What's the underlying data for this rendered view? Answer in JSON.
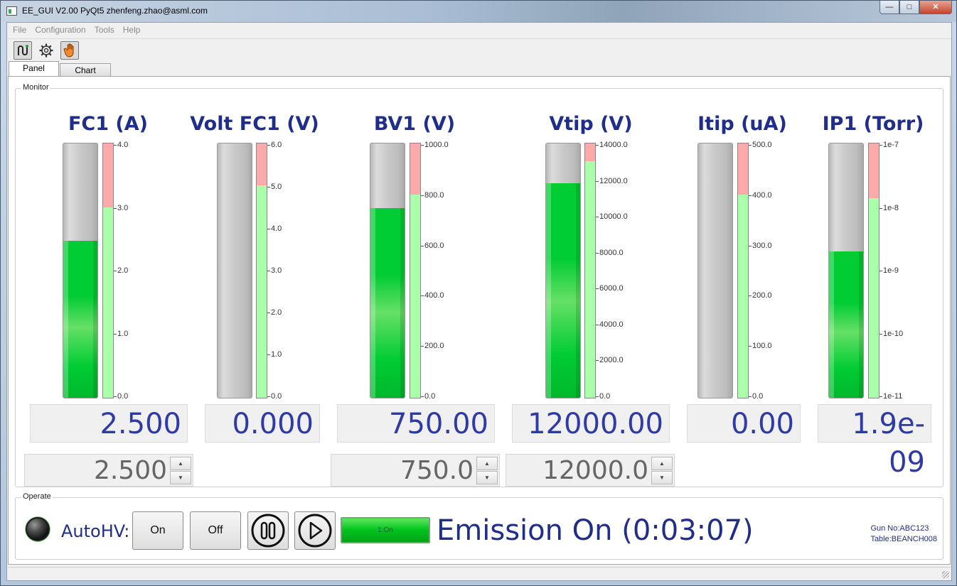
{
  "window": {
    "title": "EE_GUI V2.00 PyQt5 zhenfeng.zhao@asml.com"
  },
  "menu": [
    "File",
    "Configuration",
    "Tools",
    "Help"
  ],
  "toolbar": {
    "icons": [
      "connect-icon",
      "gear-icon",
      "hand-icon"
    ]
  },
  "tabs": [
    {
      "label": "Panel",
      "selected": true
    },
    {
      "label": "Chart",
      "selected": false
    }
  ],
  "monitor": {
    "title": "Monitor",
    "gauges": [
      {
        "id": "fc1",
        "title": "FC1 (A)",
        "readout": "2.500",
        "setpoint": "2.500",
        "has_setpoint": true,
        "fill_fraction": 0.617,
        "red_fraction": 0.25,
        "ticks": [
          "4.0",
          "3.0",
          "2.0",
          "1.0",
          "0.0"
        ]
      },
      {
        "id": "voltfc1",
        "title": "Volt FC1  (V)",
        "readout": "0.000",
        "has_setpoint": false,
        "fill_fraction": 0.0,
        "red_fraction": 0.166,
        "ticks": [
          "6.0",
          "5.0",
          "4.0",
          "3.0",
          "2.0",
          "1.0",
          "0.0"
        ]
      },
      {
        "id": "bv1",
        "title": "BV1 (V)",
        "readout": "750.00",
        "setpoint": "750.0",
        "has_setpoint": true,
        "fill_fraction": 0.745,
        "red_fraction": 0.2,
        "ticks": [
          "1000.0",
          "800.0",
          "600.0",
          "400.0",
          "200.0",
          "0.0"
        ]
      },
      {
        "id": "vtip",
        "title": "Vtip (V)",
        "readout": "12000.00",
        "setpoint": "12000.0",
        "has_setpoint": true,
        "fill_fraction": 0.845,
        "red_fraction": 0.07,
        "ticks": [
          "14000.0",
          "12000.0",
          "10000.0",
          "8000.0",
          "6000.0",
          "4000.0",
          "2000.0",
          "0.0"
        ]
      },
      {
        "id": "itip",
        "title": "Itip (uA)",
        "readout": "0.00",
        "has_setpoint": false,
        "fill_fraction": 0.0,
        "red_fraction": 0.2,
        "ticks": [
          "500.0",
          "400.0",
          "300.0",
          "200.0",
          "100.0",
          "0.0"
        ]
      },
      {
        "id": "ip1",
        "title": "IP1 (Torr)",
        "readout": "1.9e-09",
        "has_setpoint": false,
        "fill_fraction": 0.575,
        "red_fraction": 0.215,
        "ticks": [
          "1e-7",
          "1e-8",
          "1e-9",
          "1e-10",
          "1e-11"
        ]
      }
    ]
  },
  "operate": {
    "title": "Operate",
    "autohv_label": "AutoHV:",
    "on_label": "On",
    "off_label": "Off",
    "status_label": "1:On",
    "emission_text": "Emission On  (0:03:07)",
    "gun_no": "Gun No:ABC123",
    "table": "Table:BEANCH008"
  },
  "colors": {
    "accent": "#1f2e8a",
    "readout": "#2e3aa8",
    "fill_green": "#00cc33",
    "band_red": "#ffaaaa",
    "band_green": "#aaffaa"
  }
}
